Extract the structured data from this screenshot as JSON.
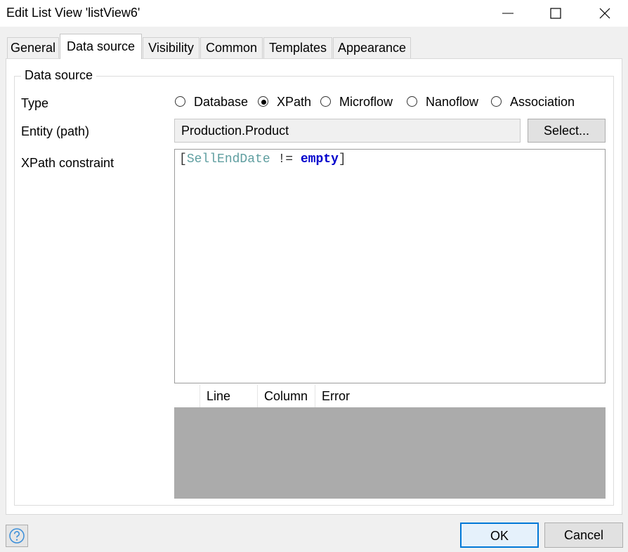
{
  "window": {
    "title": "Edit List View 'listView6'"
  },
  "tabs": [
    {
      "label": "General",
      "active": false
    },
    {
      "label": "Data source",
      "active": true
    },
    {
      "label": "Visibility",
      "active": false
    },
    {
      "label": "Common",
      "active": false
    },
    {
      "label": "Templates",
      "active": false
    },
    {
      "label": "Appearance",
      "active": false
    }
  ],
  "group": {
    "title": "Data source",
    "type_label": "Type",
    "types": [
      {
        "label": "Database",
        "selected": false
      },
      {
        "label": "XPath",
        "selected": true
      },
      {
        "label": "Microflow",
        "selected": false
      },
      {
        "label": "Nanoflow",
        "selected": false
      },
      {
        "label": "Association",
        "selected": false
      }
    ],
    "entity_label": "Entity (path)",
    "entity_value": "Production.Product",
    "select_button": "Select...",
    "xpath_label": "XPath constraint",
    "xpath": {
      "open_bracket": "[",
      "attribute": "SellEndDate",
      "operator": " != ",
      "keyword": "empty",
      "close_bracket": "]"
    },
    "errors_table": {
      "columns": [
        "Line",
        "Column",
        "Error"
      ]
    }
  },
  "footer": {
    "ok_button": "OK",
    "cancel_button": "Cancel"
  },
  "colors": {
    "xpath_attribute": "#5f9ea0",
    "xpath_keyword": "#0000cc",
    "ok_border": "#0078d7"
  },
  "icons": {
    "help": "help-icon",
    "minimize": "minimize-icon",
    "maximize": "maximize-icon",
    "close": "close-icon"
  }
}
